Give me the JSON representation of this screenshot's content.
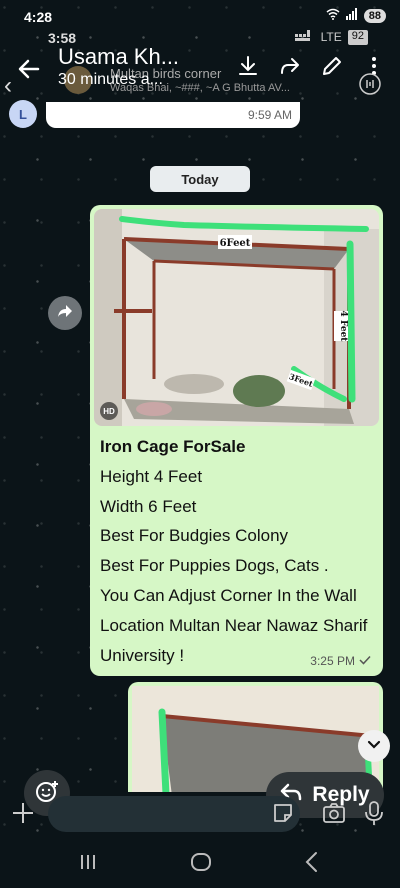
{
  "status": {
    "time": "4:28",
    "battery": "88",
    "ghost_time": "3:58",
    "ghost_network": "LTE",
    "ghost_battery": "92"
  },
  "header": {
    "name": "Usama Kh...",
    "subtitle": "30 minutes a...",
    "group_title": "Multan birds corner",
    "group_members": "Waqas Bhai, ~###, ~A G Bhutta AV..."
  },
  "previous_message": {
    "avatar_letter": "L",
    "time": "9:59 AM"
  },
  "date_chip": "Today",
  "message": {
    "image_labels": {
      "top": "6Feet",
      "side": "4 Feet",
      "corner": "3Feet",
      "hd": "HD"
    },
    "lines": [
      "Iron Cage ForSale",
      "Height 4 Feet",
      "Width 6 Feet",
      "Best For Budgies Colony",
      "Best For Puppies Dogs, Cats .",
      "You Can Adjust Corner In the Wall",
      "Location Multan Near Nawaz Sharif",
      "University !"
    ],
    "time": "3:25 PM",
    "status": "sent"
  },
  "reply_button": "Reply",
  "input": {
    "placeholder": ""
  },
  "colors": {
    "bubble": "#d6f7c6",
    "background": "#0b1418",
    "highlight": "#3ee07a"
  }
}
